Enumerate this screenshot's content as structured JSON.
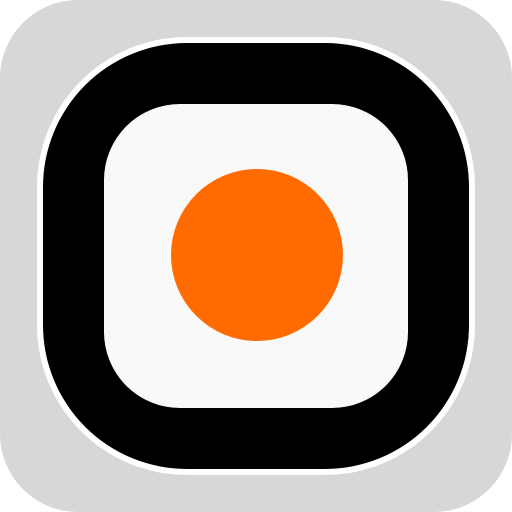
{
  "icon": {
    "name": "record-app-icon",
    "colors": {
      "tile_background": "#d7d7d7",
      "outer_outline": "#ffffff",
      "frame": "#000000",
      "inner_panel": "#f9f9f9",
      "record_dot": "#ff6b00"
    }
  }
}
